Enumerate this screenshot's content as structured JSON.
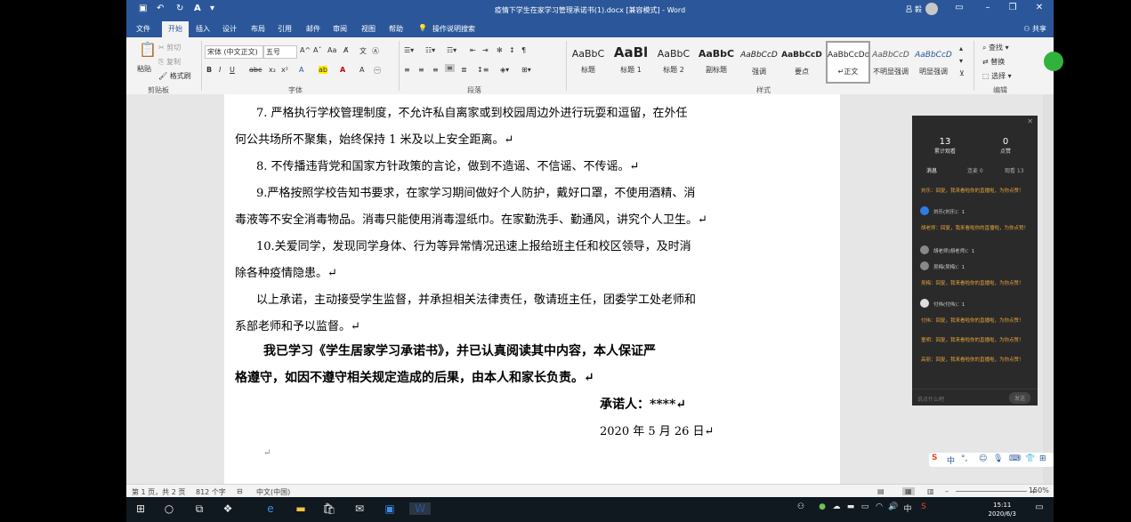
{
  "window": {
    "title": "疫情下学生在家学习管理承诺书(1).docx [兼容模式] - Word",
    "user": "吕 毅",
    "share": "共享"
  },
  "tabs": [
    "文件",
    "开始",
    "插入",
    "设计",
    "布局",
    "引用",
    "邮件",
    "审阅",
    "视图",
    "帮助"
  ],
  "tell_me": "操作说明搜索",
  "ribbon": {
    "clipboard": {
      "paste": "粘贴",
      "cut": "剪切",
      "copy": "复制",
      "format_painter": "格式刷",
      "label": "剪贴板"
    },
    "font": {
      "name": "宋体 (中文正文)",
      "size": "五号",
      "label": "字体"
    },
    "paragraph": {
      "label": "段落"
    },
    "styles": {
      "label": "样式",
      "items": [
        {
          "sample": "AaBbC",
          "name": "标题"
        },
        {
          "sample": "AaBl",
          "name": "标题 1"
        },
        {
          "sample": "AaBbC",
          "name": "标题 2"
        },
        {
          "sample": "AaBbC",
          "name": "副标题"
        },
        {
          "sample": "AaBbCcD",
          "name": "强调"
        },
        {
          "sample": "AaBbCcD",
          "name": "要点"
        },
        {
          "sample": "AaBbCcDd",
          "name": "↵正文"
        },
        {
          "sample": "AaBbCcD",
          "name": "不明显强调"
        },
        {
          "sample": "AaBbCcD",
          "name": "明显强调"
        }
      ]
    },
    "editing": {
      "find": "查找",
      "replace": "替换",
      "select": "选择",
      "label": "编辑"
    }
  },
  "document": {
    "lines": [
      "7. 严格执行学校管理制度，不允许私自离家或到校园周边外进行玩耍和逗留，在外任",
      "何公共场所不聚集，始终保持 1 米及以上安全距离。↵",
      "8. 不传播违背党和国家方针政策的言论，做到不造谣、不信谣、不传谣。↵",
      "9.严格按照学校告知书要求，在家学习期间做好个人防护，戴好口罩，不使用酒精、消",
      "毒液等不安全消毒物品。消毒只能使用消毒湿纸巾。在家勤洗手、勤通风，讲究个人卫生。↵",
      "10.关爱同学，发现同学身体、行为等异常情况迅速上报给班主任和校区领导，及时消",
      "除各种疫情隐患。↵",
      "以上承诺，主动接受学生监督，并承担相关法律责任，敬请班主任，团委学工处老师和",
      "系部老师和予以监督。↵"
    ],
    "bold_lines": [
      "我已学习《学生居家学习承诺书》，并已认真阅读其中内容，本人保证严",
      "格遵守，如因不遵守相关规定造成的后果，由本人和家长负责。↵"
    ],
    "signer": "承诺人：****↵",
    "date": "2020 年 5 月 26 日↵",
    "end_mark": "↵"
  },
  "status_bar": {
    "page": "第 1 页，共 2 页",
    "words": "812 个字",
    "language": "中文(中国)",
    "zoom": "150%"
  },
  "chat_panel": {
    "stats": [
      {
        "value": "13",
        "label": "累计观看"
      },
      {
        "value": "0",
        "label": "点赞"
      }
    ],
    "tabs": [
      "消息",
      "连麦 0",
      "观看 13"
    ],
    "messages": [
      {
        "kind": "sys",
        "text": "刘乐：回复，我来看啦你的直播啦，为你点赞！"
      },
      {
        "kind": "usr",
        "text": "刘乐(刘乐)：1"
      },
      {
        "kind": "sys",
        "text": "胡老师：回复，我来看啦你的直播啦，为你点赞！"
      },
      {
        "kind": "usr",
        "text": "胡老师(胡老师)：1"
      },
      {
        "kind": "usr",
        "text": "吴梅(吴梅)：1"
      },
      {
        "kind": "sys",
        "text": "吴梅：回复，我来看啦你的直播啦，为你点赞！"
      },
      {
        "kind": "usr",
        "text": "付伟(付伟)：1"
      },
      {
        "kind": "sys",
        "text": "付伟：回复，我来看啦你的直播啦，为你点赞！"
      },
      {
        "kind": "sys",
        "text": "童明：回复，我来看啦你的直播啦，为你点赞！"
      },
      {
        "kind": "sys",
        "text": "高丽：回复，我来看啦你的直播啦，为你点赞！"
      }
    ],
    "input_placeholder": "说点什么吧",
    "send": "发送"
  },
  "taskbar": {
    "time": "15:11",
    "date": "2020/6/3",
    "ime": "中"
  }
}
